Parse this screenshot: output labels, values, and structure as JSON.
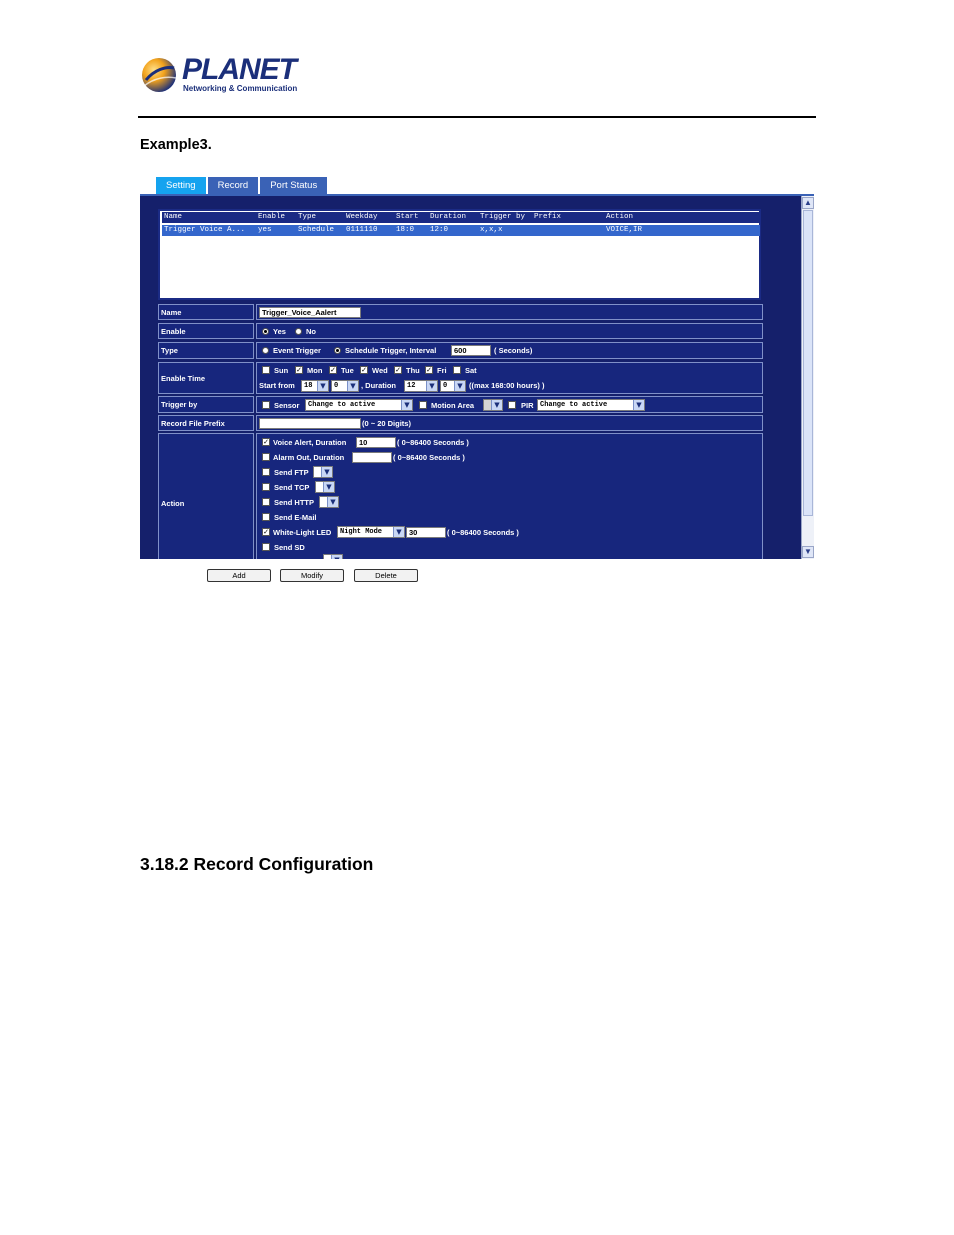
{
  "brand": {
    "name": "PLANET",
    "tagline": "Networking & Communication"
  },
  "doc_heading": "Example3.",
  "section_heading": "3.18.2 Record Configuration",
  "tabs": [
    {
      "label": "Setting",
      "active": true
    },
    {
      "label": "Record",
      "active": false
    },
    {
      "label": "Port Status",
      "active": false
    }
  ],
  "list": {
    "headers": [
      "Name",
      "Enable",
      "Type",
      "Weekday",
      "Start",
      "Duration",
      "Trigger by",
      "Prefix",
      "Action"
    ],
    "rows": [
      [
        "Trigger Voice A...",
        "yes",
        "Schedule",
        "0111110",
        "18:0",
        "12:0",
        "x,x,x",
        "",
        "VOICE,IR"
      ]
    ]
  },
  "form": {
    "name_label": "Name",
    "name_value": "Trigger_Voice_Aalert",
    "enable_label": "Enable",
    "enable_yes": "Yes",
    "enable_no": "No",
    "type_label": "Type",
    "type_event": "Event Trigger",
    "type_schedule": "Schedule Trigger, Interval",
    "interval_value": "600",
    "interval_unit": "( Seconds)",
    "enable_time_label": "Enable Time",
    "days": [
      {
        "label": "Sun",
        "checked": false
      },
      {
        "label": "Mon",
        "checked": true
      },
      {
        "label": "Tue",
        "checked": true
      },
      {
        "label": "Wed",
        "checked": true
      },
      {
        "label": "Thu",
        "checked": true
      },
      {
        "label": "Fri",
        "checked": true
      },
      {
        "label": "Sat",
        "checked": false
      }
    ],
    "start_from_label": "Start from",
    "start_hour": "18",
    "start_min": "0",
    "duration_label": ", Duration",
    "duration_hour": "12",
    "duration_min": "0",
    "duration_hint": "((max 168:00 hours) )",
    "trigger_label": "Trigger by",
    "sensor_label": "Sensor",
    "sensor_option": "Change to active",
    "motion_label": "Motion Area",
    "pir_label": "PIR",
    "pir_option": "Change to active",
    "prefix_label": "Record File Prefix",
    "prefix_value": "",
    "prefix_hint": "(0 ~ 20 Digits)",
    "action_label": "Action",
    "voice_label": "Voice Alert, Duration",
    "voice_value": "10",
    "voice_hint": "( 0~86400 Seconds )",
    "alarm_label": "Alarm Out, Duration",
    "alarm_value": "",
    "alarm_hint": "( 0~86400 Seconds )",
    "ftp_label": "Send FTP",
    "tcp_label": "Send TCP",
    "http_label": "Send HTTP",
    "email_label": "Send E-Mail",
    "led_label": "White-Light LED",
    "led_option": "Night Mode",
    "led_value": "30",
    "led_hint": "( 0~86400 Seconds )",
    "sd_label": "Send SD"
  },
  "buttons": {
    "add": "Add",
    "modify": "Modify",
    "delete": "Delete"
  },
  "colors": {
    "panel": "#15206b",
    "tab_active": "#15a3ef",
    "tab": "#3a62b6",
    "selected_row": "#3366cc"
  }
}
